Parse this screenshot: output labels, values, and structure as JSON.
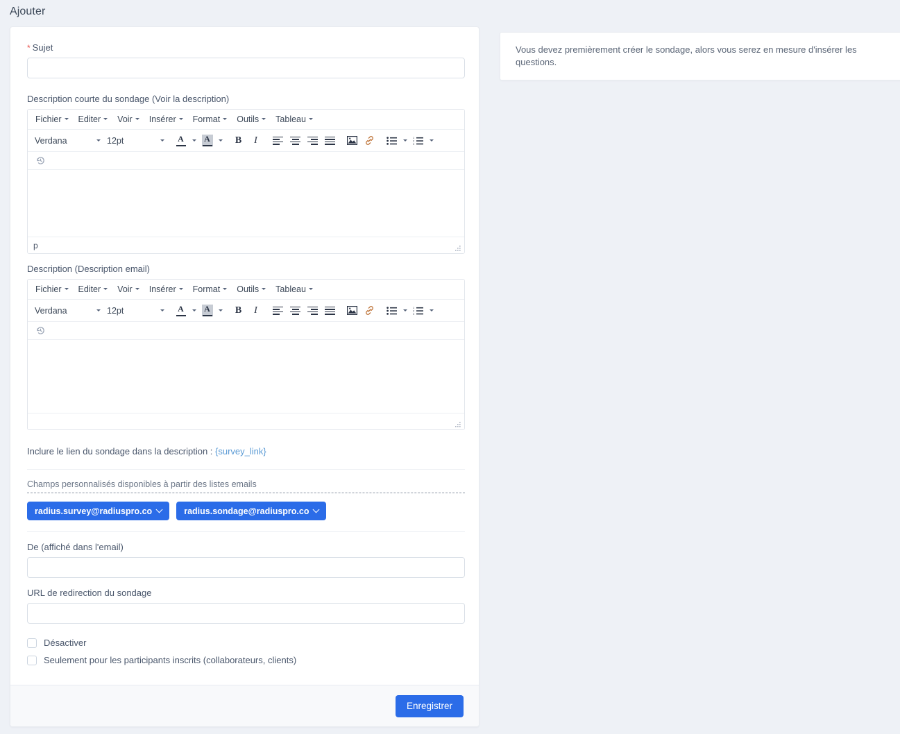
{
  "page": {
    "title": "Ajouter"
  },
  "form": {
    "subject": {
      "label": "Sujet",
      "required_marker": "*",
      "value": "",
      "placeholder": ""
    },
    "short_description": {
      "label": "Description courte du sondage (Voir la description)"
    },
    "email_description": {
      "label": "Description (Description email)"
    },
    "survey_link_row": {
      "text": "Inclure le lien du sondage dans la description : ",
      "token": "{survey_link}"
    },
    "custom_fields": {
      "label": "Champs personnalisés disponibles à partir des listes emails",
      "chips": [
        {
          "label": "radius.survey@radiuspro.co",
          "icon": "chevron-down-icon"
        },
        {
          "label": "radius.sondage@radiuspro.co",
          "icon": "chevron-down-icon"
        }
      ]
    },
    "from": {
      "label": "De (affiché dans l'email)",
      "value": "",
      "placeholder": ""
    },
    "redirect_url": {
      "label": "URL de redirection du sondage",
      "value": "",
      "placeholder": ""
    },
    "checkboxes": [
      {
        "label": "Désactiver",
        "checked": false
      },
      {
        "label": "Seulement pour les participants inscrits (collaborateurs, clients)",
        "checked": false
      }
    ],
    "save_button": "Enregistrer"
  },
  "editor": {
    "menubar": [
      {
        "label": "Fichier"
      },
      {
        "label": "Editer"
      },
      {
        "label": "Voir"
      },
      {
        "label": "Insérer"
      },
      {
        "label": "Format"
      },
      {
        "label": "Outils"
      },
      {
        "label": "Tableau"
      }
    ],
    "font_family": "Verdana",
    "font_size": "12pt",
    "toolbar_icons": [
      "text-color-icon",
      "text-color-dropdown-icon",
      "background-color-icon",
      "background-color-dropdown-icon",
      "bold-icon",
      "italic-icon",
      "align-left-icon",
      "align-center-icon",
      "align-right-icon",
      "align-justify-icon",
      "insert-image-icon",
      "insert-link-icon",
      "bullet-list-icon",
      "bullet-list-dropdown-icon",
      "numbered-list-icon",
      "numbered-list-dropdown-icon"
    ],
    "row3_icon": "restore-draft-icon",
    "bold_glyph": "B",
    "italic_glyph": "I",
    "color_glyph": "A",
    "statusbar_path_editor1": "p",
    "statusbar_path_editor2": "",
    "resize_handle": "resize-grip-icon"
  },
  "right_panel": {
    "note": "Vous devez premièrement créer le sondage, alors vous serez en mesure d'insérer les questions."
  },
  "colors": {
    "accent": "#2b6ce8",
    "page_bg": "#eef1f6",
    "card_bg": "#ffffff",
    "required": "#e8544f",
    "link_token": "#5b9bd5"
  }
}
